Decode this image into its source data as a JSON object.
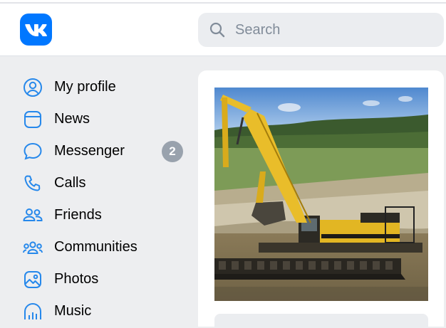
{
  "brand": {
    "logo_text": "VK",
    "color": "#0077ff"
  },
  "search": {
    "placeholder": "Search",
    "icon": "search-icon"
  },
  "sidebar": {
    "items": [
      {
        "label": "My profile",
        "icon": "user-circle-icon"
      },
      {
        "label": "News",
        "icon": "news-icon"
      },
      {
        "label": "Messenger",
        "icon": "chat-bubble-icon",
        "badge": "2"
      },
      {
        "label": "Calls",
        "icon": "phone-icon"
      },
      {
        "label": "Friends",
        "icon": "friends-icon"
      },
      {
        "label": "Communities",
        "icon": "communities-icon"
      },
      {
        "label": "Photos",
        "icon": "photo-icon"
      },
      {
        "label": "Music",
        "icon": "music-icon"
      }
    ]
  },
  "feed": {
    "post_image": "yellow long-reach excavator on pontoon in water"
  },
  "colors": {
    "page_bg": "#edeef0",
    "accent": "#0077ff",
    "icon": "#2688eb",
    "badge": "#99a2ad"
  }
}
